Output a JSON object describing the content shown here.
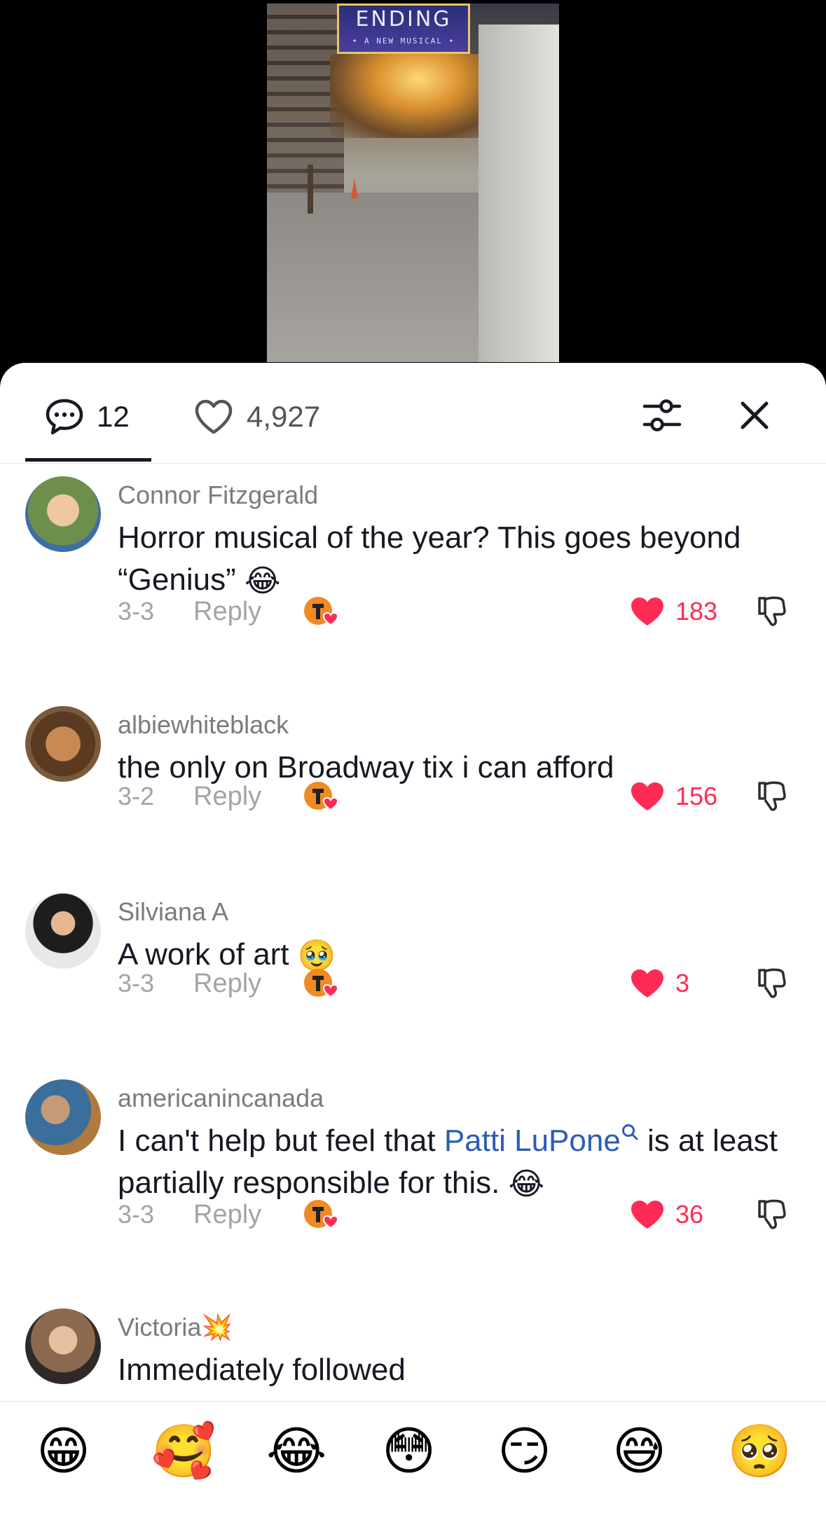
{
  "video": {
    "marquee_title": "ENDING",
    "marquee_subtitle": "• A NEW MUSICAL •"
  },
  "header": {
    "comments_count": "12",
    "likes_count": "4,927"
  },
  "icons": {
    "comments": "speech-bubble-icon",
    "likes": "heart-outline-icon",
    "filter": "sliders-icon",
    "close": "close-icon"
  },
  "comments": [
    {
      "username": "Connor Fitzgerald",
      "text": "Horror musical of the year? This goes beyond “Genius” ",
      "emoji": "😂",
      "date": "3-3",
      "reply": "Reply",
      "likes": "183"
    },
    {
      "username": "albiewhiteblack",
      "text": "the only on Broadway tix i can afford",
      "date": "3-2",
      "reply": "Reply",
      "likes": "156"
    },
    {
      "username": "Silviana A",
      "text": "A work of art ",
      "emoji": "🥹",
      "date": "3-3",
      "reply": "Reply",
      "likes": "3"
    },
    {
      "username": "americanincanada",
      "text_before": "I can't help but feel that ",
      "link": "Patti LuPone",
      "text_after": " is at least partially responsible for this. ",
      "emoji": "😂",
      "date": "3-3",
      "reply": "Reply",
      "likes": "36"
    },
    {
      "username": "Victoria",
      "username_emoji": "💥",
      "text": "Immediately followed"
    }
  ],
  "quick_emojis": [
    "😁",
    "🥰",
    "😂",
    "😳",
    "😏",
    "😅",
    "🥺"
  ],
  "colors": {
    "accent_like": "#fe2c55",
    "link": "#2b5db4",
    "text": "#161823",
    "muted": "#a3a4a8"
  }
}
